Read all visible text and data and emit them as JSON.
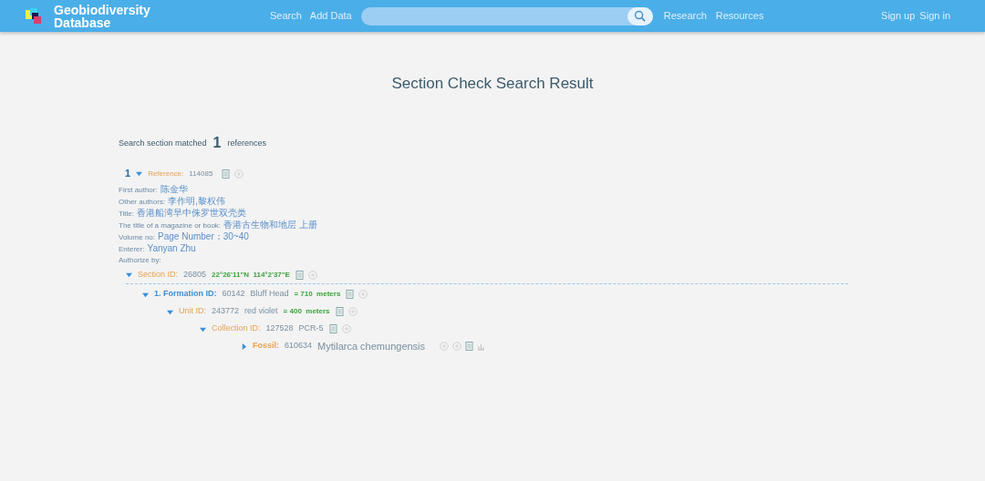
{
  "header": {
    "brand": "Geobiodiversity Database",
    "nav_left": [
      "Search",
      "Add Data"
    ],
    "nav_right": [
      "Research",
      "Resources"
    ],
    "account": [
      "Sign up",
      "Sign in"
    ]
  },
  "title": "Section Check Search Result",
  "summary": {
    "before": "Search section matched",
    "count": "1",
    "after": "references"
  },
  "reference": {
    "number": "1",
    "label": "Reference:",
    "id": "114085",
    "expanded": true,
    "fields": [
      {
        "label": "First author:",
        "value": "陈金华"
      },
      {
        "label": "Other authors:",
        "value": "李作明,黎权伟"
      },
      {
        "label": "Title:",
        "value": "香港船湾早中侏罗世双壳类"
      },
      {
        "label": "The title of a magazine or book:",
        "value": "香港古生物和地层 上册"
      },
      {
        "label": "Volume no:",
        "value": "Page Number：30~40"
      },
      {
        "label": "Enterer:",
        "value": "Yanyan Zhu"
      },
      {
        "label": "Authorize by:"
      }
    ],
    "tree": [
      {
        "kind": "section",
        "label": "Section ID:",
        "id": "26805",
        "measure": "22°26'11\"N  114°2'37\"E",
        "expanded": true,
        "children": [
          {
            "kind": "formation",
            "label": "1. Formation ID:",
            "id": "60142",
            "name": "Bluff Head",
            "measure": "= 710  meters",
            "expanded": true,
            "children": [
              {
                "kind": "unit",
                "label": "Unit ID:",
                "id": "243772",
                "name": "red violet",
                "measure": "= 400  meters",
                "expanded": true,
                "children": [
                  {
                    "kind": "collection",
                    "label": "Collection ID:",
                    "id": "127528",
                    "name": "PCR-5",
                    "expanded": true,
                    "children": [
                      {
                        "kind": "fossil",
                        "label": "Fossil:",
                        "id": "610634",
                        "name": "Mytilarca chemungensis",
                        "expanded": false
                      }
                    ]
                  }
                ]
              }
            ]
          }
        ]
      }
    ]
  }
}
